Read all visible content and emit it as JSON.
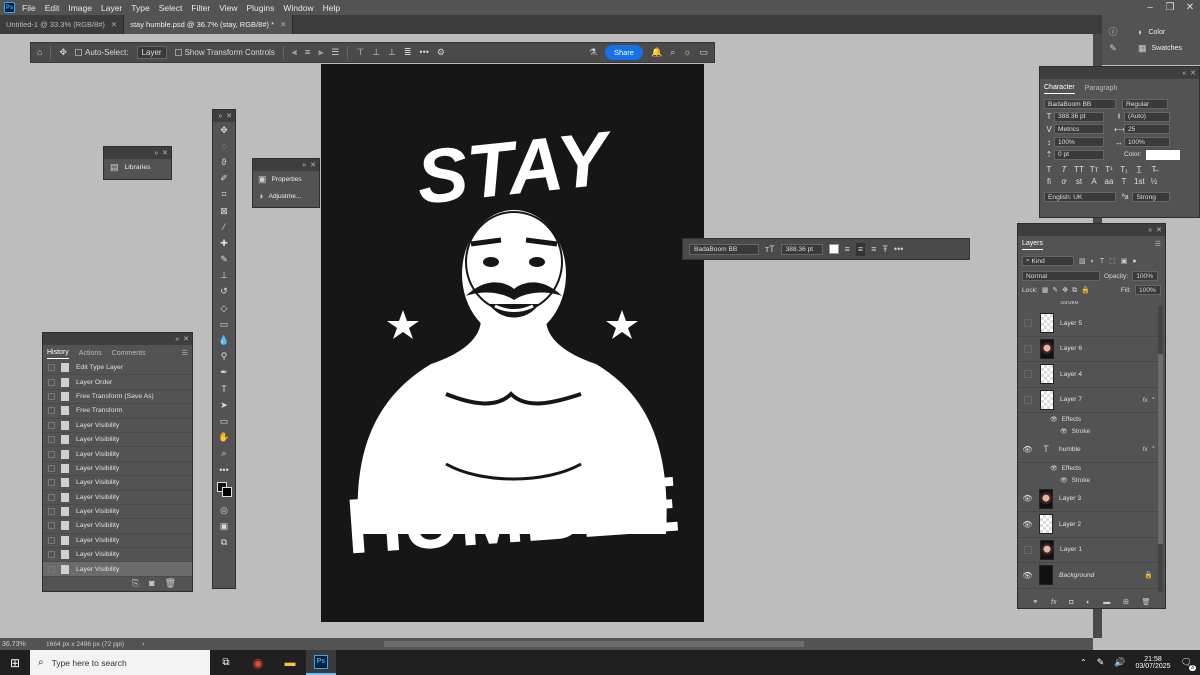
{
  "menubar": {
    "items": [
      "File",
      "Edit",
      "Image",
      "Layer",
      "Type",
      "Select",
      "Filter",
      "View",
      "Plugins",
      "Window",
      "Help"
    ]
  },
  "doc_tabs": [
    {
      "label": "Untitled-1 @ 33.3% (RGB/8#)"
    },
    {
      "label": "stay humble.psd @ 36.7% (stay, RGB/8#) *"
    }
  ],
  "options_bar": {
    "auto_select_label": "Auto-Select:",
    "auto_select_value": "Layer",
    "transform_label": "Show Transform Controls",
    "share_label": "Share"
  },
  "libraries_panel": {
    "label": "Libraries"
  },
  "properties_panel": {
    "items": [
      "Properties",
      "Adjustme..."
    ]
  },
  "history_panel": {
    "tabs": [
      "History",
      "Actions",
      "Comments"
    ],
    "rows": [
      "Edit Type Layer",
      "Layer Order",
      "Free Transform (Save As)",
      "Free Transform",
      "Layer Visibility",
      "Layer Visibility",
      "Layer Visibility",
      "Layer Visibility",
      "Layer Visibility",
      "Layer Visibility",
      "Layer Visibility",
      "Layer Visibility",
      "Layer Visibility",
      "Layer Visibility",
      "Layer Visibility"
    ]
  },
  "artwork": {
    "top_text": "STAY",
    "bottom_text": "HUMBLE"
  },
  "text_toolbar": {
    "font": "BadaBoom BB",
    "size": "388.36 pt"
  },
  "character_panel": {
    "tabs": [
      "Character",
      "Paragraph"
    ],
    "font": "BadaBoom BB",
    "style": "Regular",
    "size": "388.36 pt",
    "leading": "(Auto)",
    "kerning": "Metrics",
    "tracking": "25",
    "vscale": "100%",
    "hscale": "100%",
    "baseline": "0 pt",
    "color_label": "Color:",
    "language": "English: UK",
    "antialias": "Strong"
  },
  "right_dock": {
    "color_label": "Color",
    "swatches_label": "Swatches"
  },
  "layers_panel": {
    "title": "Layers",
    "filter": "Kind",
    "blend": "Normal",
    "opacity_label": "Opacity:",
    "opacity": "100%",
    "lock_label": "Lock:",
    "fill_label": "Fill:",
    "fill": "100%",
    "top_cut_label": "Stroke",
    "effects_label": "Effects",
    "stroke_label": "Stroke",
    "layers": [
      {
        "name": "Layer 5",
        "visible": false,
        "thumb": "checker"
      },
      {
        "name": "Layer 6",
        "visible": false,
        "thumb": "img"
      },
      {
        "name": "Layer 4",
        "visible": false,
        "thumb": "checker"
      },
      {
        "name": "Layer 7",
        "visible": false,
        "thumb": "checker",
        "fx": true
      },
      {
        "name": "humble",
        "visible": true,
        "thumb": "type",
        "fx": true
      },
      {
        "name": "Layer 3",
        "visible": true,
        "thumb": "img"
      },
      {
        "name": "Layer 2",
        "visible": true,
        "thumb": "checker"
      },
      {
        "name": "Layer 1",
        "visible": false,
        "thumb": "img"
      },
      {
        "name": "Background",
        "visible": true,
        "thumb": "dark",
        "locked": true
      }
    ]
  },
  "status_bar": {
    "zoom": "36.73%",
    "doc_info": "1664 px x 2496 px (72 ppi)"
  },
  "taskbar": {
    "search_placeholder": "Type here to search",
    "time": "21:58",
    "date": "03/07/2025",
    "notif_count": "3"
  }
}
